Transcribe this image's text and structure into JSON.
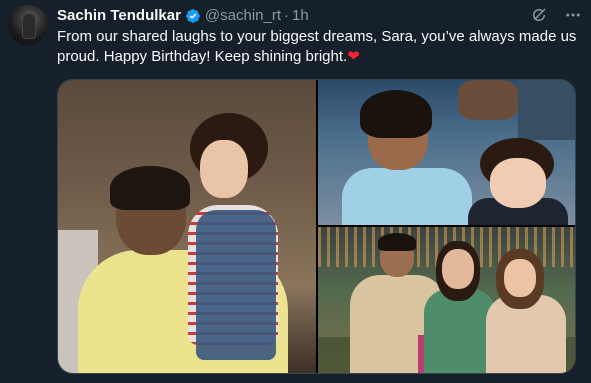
{
  "tweet": {
    "author_name": "Sachin Tendulkar",
    "handle": "@sachin_rt",
    "separator": "·",
    "time": "1h",
    "text": "From our shared laughs to your biggest dreams, Sara, you’ve always made us proud. Happy Birthday! Keep shining bright.",
    "emoji": "❤️",
    "verified_icon": "verified-badge-icon",
    "header_icons": [
      "grok-icon",
      "more-options-icon"
    ]
  },
  "colors": {
    "background": "#15202b",
    "text_primary": "#f7f9f9",
    "text_secondary": "#8b98a5",
    "verified": "#1d9bf0",
    "heart": "#f4212e"
  }
}
